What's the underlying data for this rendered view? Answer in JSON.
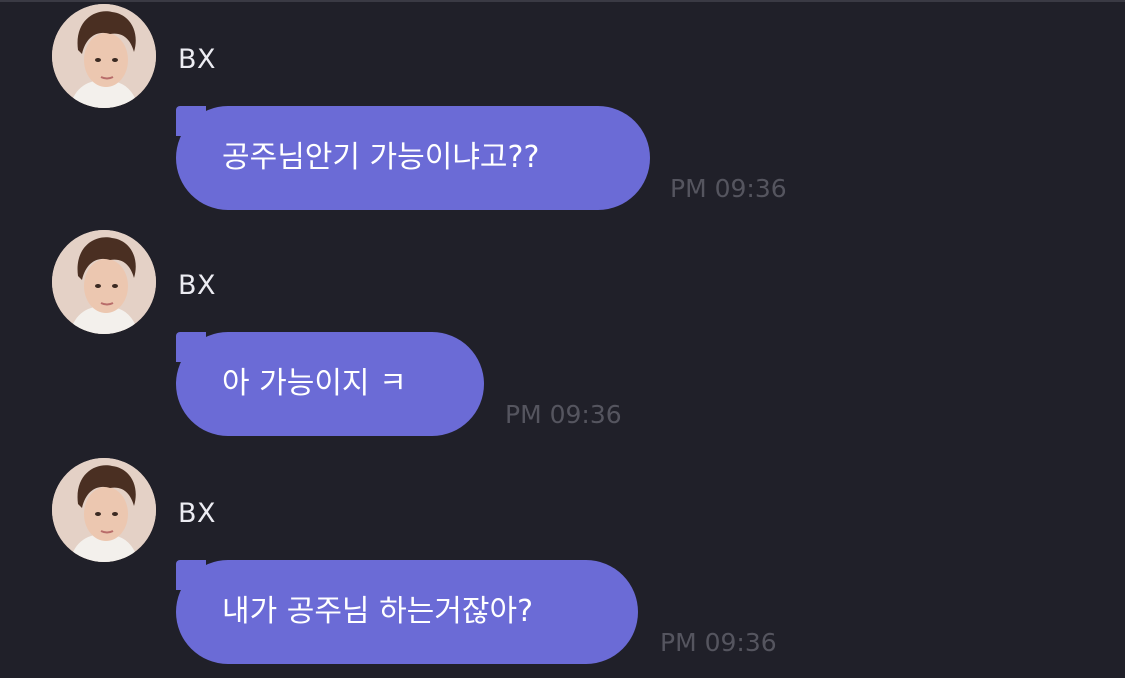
{
  "messages": [
    {
      "sender": "BX",
      "text": "공주님안기 가능이냐고??",
      "time": "PM 09:36"
    },
    {
      "sender": "BX",
      "text": "아 가능이지 ㅋ",
      "time": "PM 09:36"
    },
    {
      "sender": "BX",
      "text": "내가 공주님 하는거잖아?",
      "time": "PM 09:36"
    }
  ],
  "colors": {
    "background": "#202029",
    "bubble": "#6b6bd6",
    "sender_text": "#ececf2",
    "time_text": "#55555f"
  }
}
